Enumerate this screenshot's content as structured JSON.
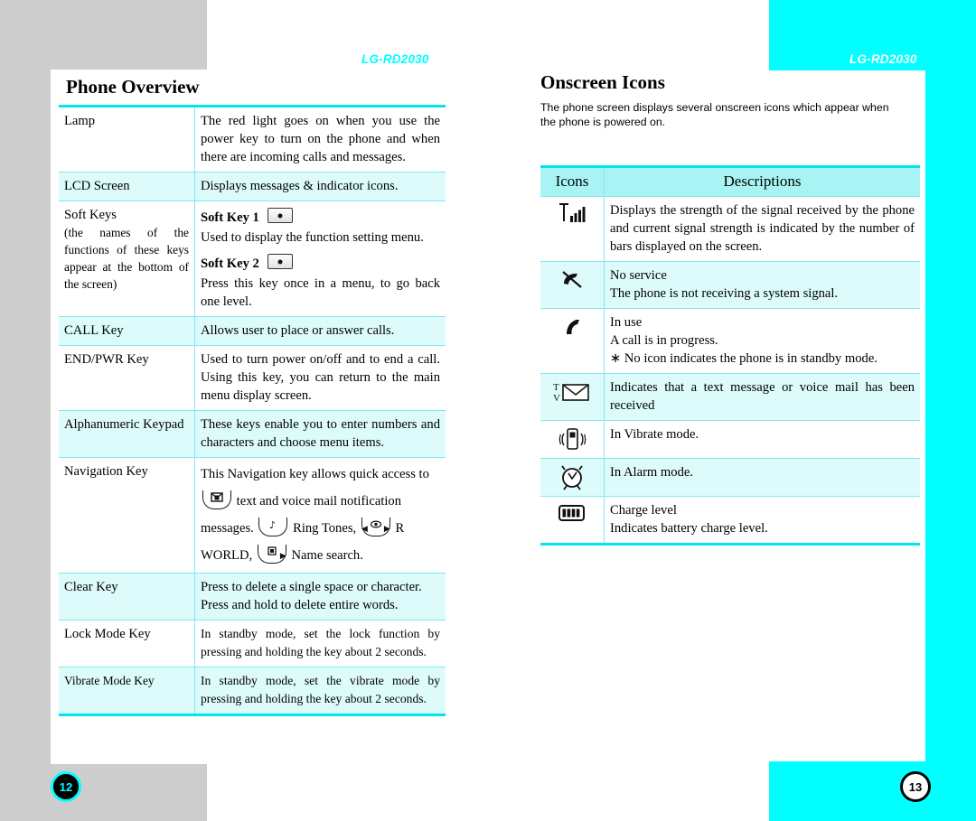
{
  "document": {
    "running_head_left": "LG-RD2030",
    "running_head_right": "LG-RD2030",
    "page_number_left": "12",
    "page_number_right": "13",
    "accent_cyan": "#00ffff",
    "rule_cyan": "#00e5ee",
    "row_alt_bg": "#ddfbfb",
    "header_bg": "#a8f4f4",
    "frame_gray": "#cdcdcd"
  },
  "left_page": {
    "title": "Phone Overview",
    "rows": [
      {
        "term": "Lamp",
        "desc": "The red light goes on when you use the power key to turn on the phone and when there are incoming calls and messages."
      },
      {
        "term": "LCD Screen",
        "desc": "Displays messages & indicator icons."
      },
      {
        "term": "Soft Keys",
        "term_note": "(the names of the functions of these keys appear at the bottom of the screen)",
        "softkey1_label": "Soft Key 1",
        "softkey1_desc": "Used to display the function setting menu.",
        "softkey2_label": "Soft Key 2",
        "softkey2_desc": "Press this key once in a menu, to go back one level."
      },
      {
        "term": "CALL Key",
        "desc": "Allows user to place or answer calls."
      },
      {
        "term": "END/PWR Key",
        "desc": "Used to turn power on/off and to end a call. Using this key, you can return to the main menu display screen."
      },
      {
        "term": "Alphanumeric Keypad",
        "desc": "These keys enable you to enter numbers and characters and choose menu items."
      },
      {
        "term": "Navigation Key",
        "desc_part1": "This Navigation key allows quick access to",
        "desc_part2": "text and voice mail notification messages.",
        "desc_part3": "Ring Tones,",
        "desc_part4": "R WORLD,",
        "desc_part5": "Name search."
      },
      {
        "term": "Clear Key",
        "desc": "Press to delete a single space or character. Press and hold to delete entire words."
      },
      {
        "term": "Lock Mode Key",
        "desc": "In standby mode, set the lock function by pressing and holding the key about 2 seconds."
      },
      {
        "term": "Vibrate Mode Key",
        "desc": "In standby mode, set the vibrate mode by pressing and holding the key about 2 seconds."
      }
    ]
  },
  "right_page": {
    "title": "Onscreen Icons",
    "intro": "The phone screen displays several onscreen icons which appear when the phone is powered on.",
    "table_headers": {
      "icons": "Icons",
      "descriptions": "Descriptions"
    },
    "rows": [
      {
        "icon": "signal-strength-icon",
        "desc": "Displays the strength of the signal received by the phone and current signal strength is indicated by the number of bars displayed on the screen."
      },
      {
        "icon": "no-service-icon",
        "desc_line1": "No service",
        "desc_line2": "The phone is not receiving a system signal."
      },
      {
        "icon": "in-use-handset-icon",
        "desc_line1": "In use",
        "desc_line2": "A call is in progress.",
        "desc_line3": "∗ No icon indicates the phone is in standby mode."
      },
      {
        "icon": "envelope-message-icon",
        "icon_labels": [
          "T",
          "V"
        ],
        "desc": "Indicates that a text message or voice mail has been received"
      },
      {
        "icon": "vibrate-mode-icon",
        "desc": "In Vibrate mode."
      },
      {
        "icon": "alarm-clock-icon",
        "desc": "In Alarm mode."
      },
      {
        "icon": "battery-charge-icon",
        "desc_line1": "Charge level",
        "desc_line2": "Indicates battery charge level."
      }
    ]
  }
}
